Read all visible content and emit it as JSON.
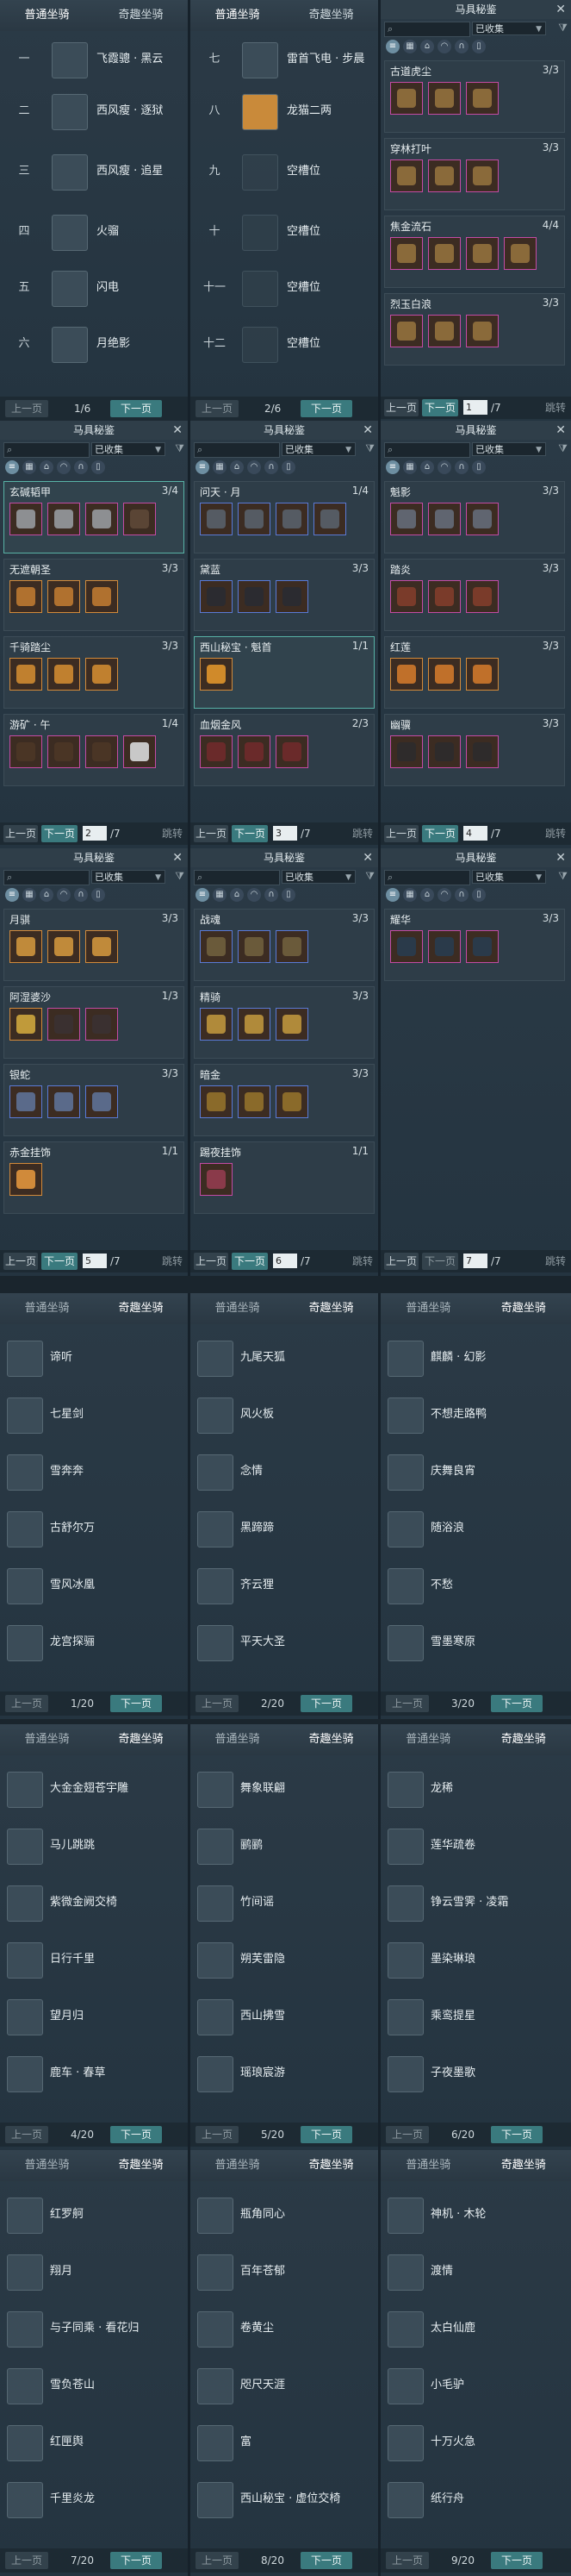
{
  "tabs": {
    "normal": "普通坐骑",
    "fun": "奇趣坐骑"
  },
  "nav": {
    "prev": "上一页",
    "next": "下一页",
    "jump": "跳转"
  },
  "codex": {
    "title": "马具秘鉴",
    "filter": "已收集"
  },
  "mounts_p1": {
    "page": "1/6",
    "items": [
      {
        "idx": "一",
        "name": "飞霞骢 · 黑云"
      },
      {
        "idx": "二",
        "name": "西风瘦 · 逐狱"
      },
      {
        "idx": "三",
        "name": "西风瘦 · 追星"
      },
      {
        "idx": "四",
        "name": "火骝"
      },
      {
        "idx": "五",
        "name": "闪电"
      },
      {
        "idx": "六",
        "name": "月绝影"
      }
    ]
  },
  "mounts_p2": {
    "page": "2/6",
    "items": [
      {
        "idx": "七",
        "name": "雷首飞电 · 步晨"
      },
      {
        "idx": "八",
        "name": "龙猫二两"
      },
      {
        "idx": "九",
        "name": "空槽位"
      },
      {
        "idx": "十",
        "name": "空槽位"
      },
      {
        "idx": "十一",
        "name": "空槽位"
      },
      {
        "idx": "十二",
        "name": "空槽位"
      }
    ]
  },
  "codex_p1": {
    "page": "1",
    "total": "/7",
    "groups": [
      {
        "name": "古道虎尘",
        "count": "3/3",
        "n": 3
      },
      {
        "name": "穿林打叶",
        "count": "3/3",
        "n": 3
      },
      {
        "name": "焦金流石",
        "count": "4/4",
        "n": 4
      },
      {
        "name": "烈玉白浪",
        "count": "3/3",
        "n": 3
      }
    ]
  },
  "codex_p2": {
    "page": "2",
    "total": "/7",
    "groups": [
      {
        "name": "玄碱韬甲",
        "count": "3/4",
        "n": 4
      },
      {
        "name": "无遮朝圣",
        "count": "3/3",
        "n": 3
      },
      {
        "name": "千骑踏尘",
        "count": "3/3",
        "n": 3
      },
      {
        "name": "游矿 · 午",
        "count": "1/4",
        "n": 4
      }
    ]
  },
  "codex_p3": {
    "page": "3",
    "total": "/7",
    "groups": [
      {
        "name": "问天 · 月",
        "count": "1/4",
        "n": 4
      },
      {
        "name": "黛蓝",
        "count": "3/3",
        "n": 3
      },
      {
        "name": "西山秘宝 · 魁首",
        "count": "1/1",
        "n": 1
      },
      {
        "name": "血烟金风",
        "count": "2/3",
        "n": 3
      }
    ]
  },
  "codex_p4": {
    "page": "4",
    "total": "/7",
    "groups": [
      {
        "name": "魁影",
        "count": "3/3",
        "n": 3
      },
      {
        "name": "踏炎",
        "count": "3/3",
        "n": 3
      },
      {
        "name": "红莲",
        "count": "3/3",
        "n": 3
      },
      {
        "name": "幽骥",
        "count": "3/3",
        "n": 3
      }
    ]
  },
  "codex_p5": {
    "page": "5",
    "total": "/7",
    "groups": [
      {
        "name": "月骐",
        "count": "3/3",
        "n": 3
      },
      {
        "name": "阿湿婆沙",
        "count": "1/3",
        "n": 3
      },
      {
        "name": "银蛇",
        "count": "3/3",
        "n": 3
      },
      {
        "name": "赤金挂饰",
        "count": "1/1",
        "n": 1
      }
    ]
  },
  "codex_p6": {
    "page": "6",
    "total": "/7",
    "groups": [
      {
        "name": "战魂",
        "count": "3/3",
        "n": 3
      },
      {
        "name": "精骑",
        "count": "3/3",
        "n": 3
      },
      {
        "name": "暗金",
        "count": "3/3",
        "n": 3
      },
      {
        "name": "踢夜挂饰",
        "count": "1/1",
        "n": 1
      }
    ]
  },
  "codex_p7": {
    "page": "7",
    "total": "/7",
    "groups": [
      {
        "name": "耀华",
        "count": "3/3",
        "n": 3
      }
    ]
  },
  "fun_p1": {
    "page": "1/20",
    "items": [
      "谛听",
      "七星剑",
      "雪奔奔",
      "古舒尔万",
      "雪风冰凰",
      "龙宫探骊"
    ]
  },
  "fun_p2": {
    "page": "2/20",
    "items": [
      "九尾天狐",
      "风火板",
      "念情",
      "黑蹄蹄",
      "齐云狸",
      "平天大圣"
    ]
  },
  "fun_p3": {
    "page": "3/20",
    "items": [
      "麒麟 · 幻影",
      "不想走路鸭",
      "庆舞良宵",
      "随浴浪",
      "不愁",
      "雪墨寒原"
    ]
  },
  "fun_p4": {
    "page": "4/20",
    "items": [
      "大金金翅苍宇雕",
      "马儿跳跳",
      "紫微金阙交椅",
      "日行千里",
      "望月归",
      "鹿车 · 春草"
    ]
  },
  "fun_p5": {
    "page": "5/20",
    "items": [
      "舞象联翩",
      "鹂鹂",
      "竹间谣",
      "朔芙雷隐",
      "西山拂雪",
      "瑶琅宸游"
    ]
  },
  "fun_p6": {
    "page": "6/20",
    "items": [
      "龙稀",
      "莲华疏卷",
      "铮云雪霁 · 凌霜",
      "墨染琳琅",
      "乘鸾提星",
      "子夜墨歌"
    ]
  },
  "fun_p7": {
    "page": "7/20",
    "items": [
      "红罗舸",
      "翔月",
      "与子同乘 · 看花归",
      "雪负苍山",
      "红匣舆",
      "千里炎龙"
    ]
  },
  "fun_p8": {
    "page": "8/20",
    "items": [
      "瓶角同心",
      "百年苍郁",
      "卷黄尘",
      "咫尺天涯",
      "富",
      "西山秘宝 · 虚位交椅"
    ]
  },
  "fun_p9": {
    "page": "9/20",
    "items": [
      "神机 · 木轮",
      "渡情",
      "太白仙鹿",
      "小毛驴",
      "十万火急",
      "纸行舟"
    ]
  }
}
